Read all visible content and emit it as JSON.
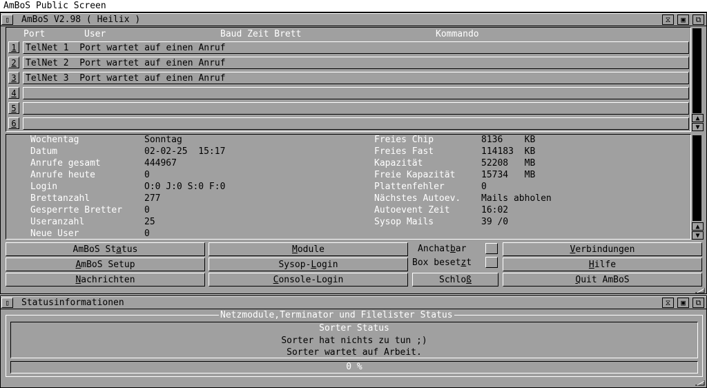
{
  "screen": {
    "title": "AmBoS Public Screen"
  },
  "main_window": {
    "title": "AmBoS V2.98 ( Heilix )",
    "columns": {
      "port": "Port",
      "user": "User",
      "baud": "Baud Zeit Brett",
      "kommando": "Kommando"
    },
    "ports": [
      {
        "num": "1",
        "text": "TelNet 1  Port wartet auf einen Anruf"
      },
      {
        "num": "2",
        "text": "TelNet 2  Port wartet auf einen Anruf"
      },
      {
        "num": "3",
        "text": "TelNet 3  Port wartet auf einen Anruf"
      },
      {
        "num": "4",
        "text": ""
      },
      {
        "num": "5",
        "text": ""
      },
      {
        "num": "6",
        "text": ""
      }
    ],
    "info_left": [
      {
        "label": "Wochentag",
        "value": "Sonntag"
      },
      {
        "label": "Datum",
        "value": "02-02-25  15:17"
      },
      {
        "label": "Anrufe gesamt",
        "value": "444967"
      },
      {
        "label": "Anrufe heute",
        "value": "0"
      },
      {
        "label": "Login",
        "value": "O:0 J:0 S:0 F:0"
      },
      {
        "label": "Brettanzahl",
        "value": "277"
      },
      {
        "label": "Gesperrte Bretter",
        "value": "0"
      },
      {
        "label": "Useranzahl",
        "value": "25"
      },
      {
        "label": "Neue User",
        "value": "0"
      }
    ],
    "info_right": [
      {
        "label": "Freies Chip",
        "value": "8136    KB"
      },
      {
        "label": "Freies Fast",
        "value": "114183  KB"
      },
      {
        "label": "Kapazität",
        "value": "52208   MB"
      },
      {
        "label": "Freie Kapazität",
        "value": "15734   MB"
      },
      {
        "label": "Plattenfehler",
        "value": "0"
      },
      {
        "label": "Nächstes Autoev.",
        "value": "Mails abholen"
      },
      {
        "label": "Autoevent Zeit",
        "value": "16:02"
      },
      {
        "label": "Sysop Mails",
        "value": "39 /0"
      }
    ],
    "buttons": {
      "status_a": "AmBoS St",
      "status_u": "a",
      "status_b": "tus",
      "setup_a": "",
      "setup_u": "A",
      "setup_b": "mBoS Setup",
      "nachrichten_a": "",
      "nachrichten_u": "N",
      "nachrichten_b": "achrichten",
      "module_a": "",
      "module_u": "M",
      "module_b": "odule",
      "sysop_a": "Sysop-",
      "sysop_u": "L",
      "sysop_b": "ogin",
      "console_a": "",
      "console_u": "C",
      "console_b": "onsole-Login",
      "anchat_a": "Anchat",
      "anchat_u": "b",
      "anchat_b": "ar",
      "besetzt_a": "Box beset",
      "besetzt_u": "z",
      "besetzt_b": "t",
      "schloss_a": "Schlo",
      "schloss_u": "ß",
      "schloss_b": "",
      "verbindungen_a": "",
      "verbindungen_u": "V",
      "verbindungen_b": "erbindungen",
      "hilfe_a": "",
      "hilfe_u": "H",
      "hilfe_b": "ilfe",
      "quit_a": "",
      "quit_u": "Q",
      "quit_b": "uit AmBoS"
    }
  },
  "status_window": {
    "title": "Statusinformationen",
    "group_title": "Netzmodule,Terminator und Filelister Status",
    "lines": [
      "Sorter Status",
      "Sorter hat nichts zu tun ;)",
      "Sorter wartet auf Arbeit."
    ],
    "progress_text": "0 %",
    "progress": 0
  },
  "icons": {
    "close": "close-icon",
    "depth": "depth-icon",
    "zoom": "zoom-icon",
    "size": "resize-icon",
    "up": "arrow-up-icon",
    "down": "arrow-down-icon"
  }
}
